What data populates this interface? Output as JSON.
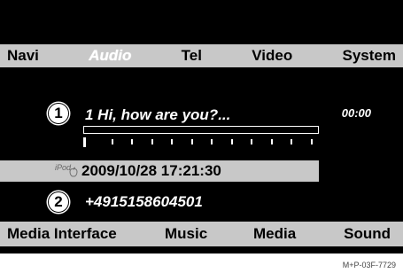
{
  "top_tabs": [
    "Navi",
    "Audio",
    "Tel",
    "Video",
    "System"
  ],
  "active_tab": "Audio",
  "track": {
    "marker": "1",
    "title": "1 Hi, how are you?...",
    "time": "00:00",
    "progress": 0
  },
  "source": {
    "logo_text": "iPod",
    "logo_icon": "apple-icon",
    "datetime": "2009/10/28 17:21:30"
  },
  "phone": {
    "marker": "2",
    "number": "+4915158604501"
  },
  "bottom_menu": [
    "Media Interface",
    "Music",
    "Media",
    "Sound"
  ],
  "caption": "M+P-03F-7729"
}
